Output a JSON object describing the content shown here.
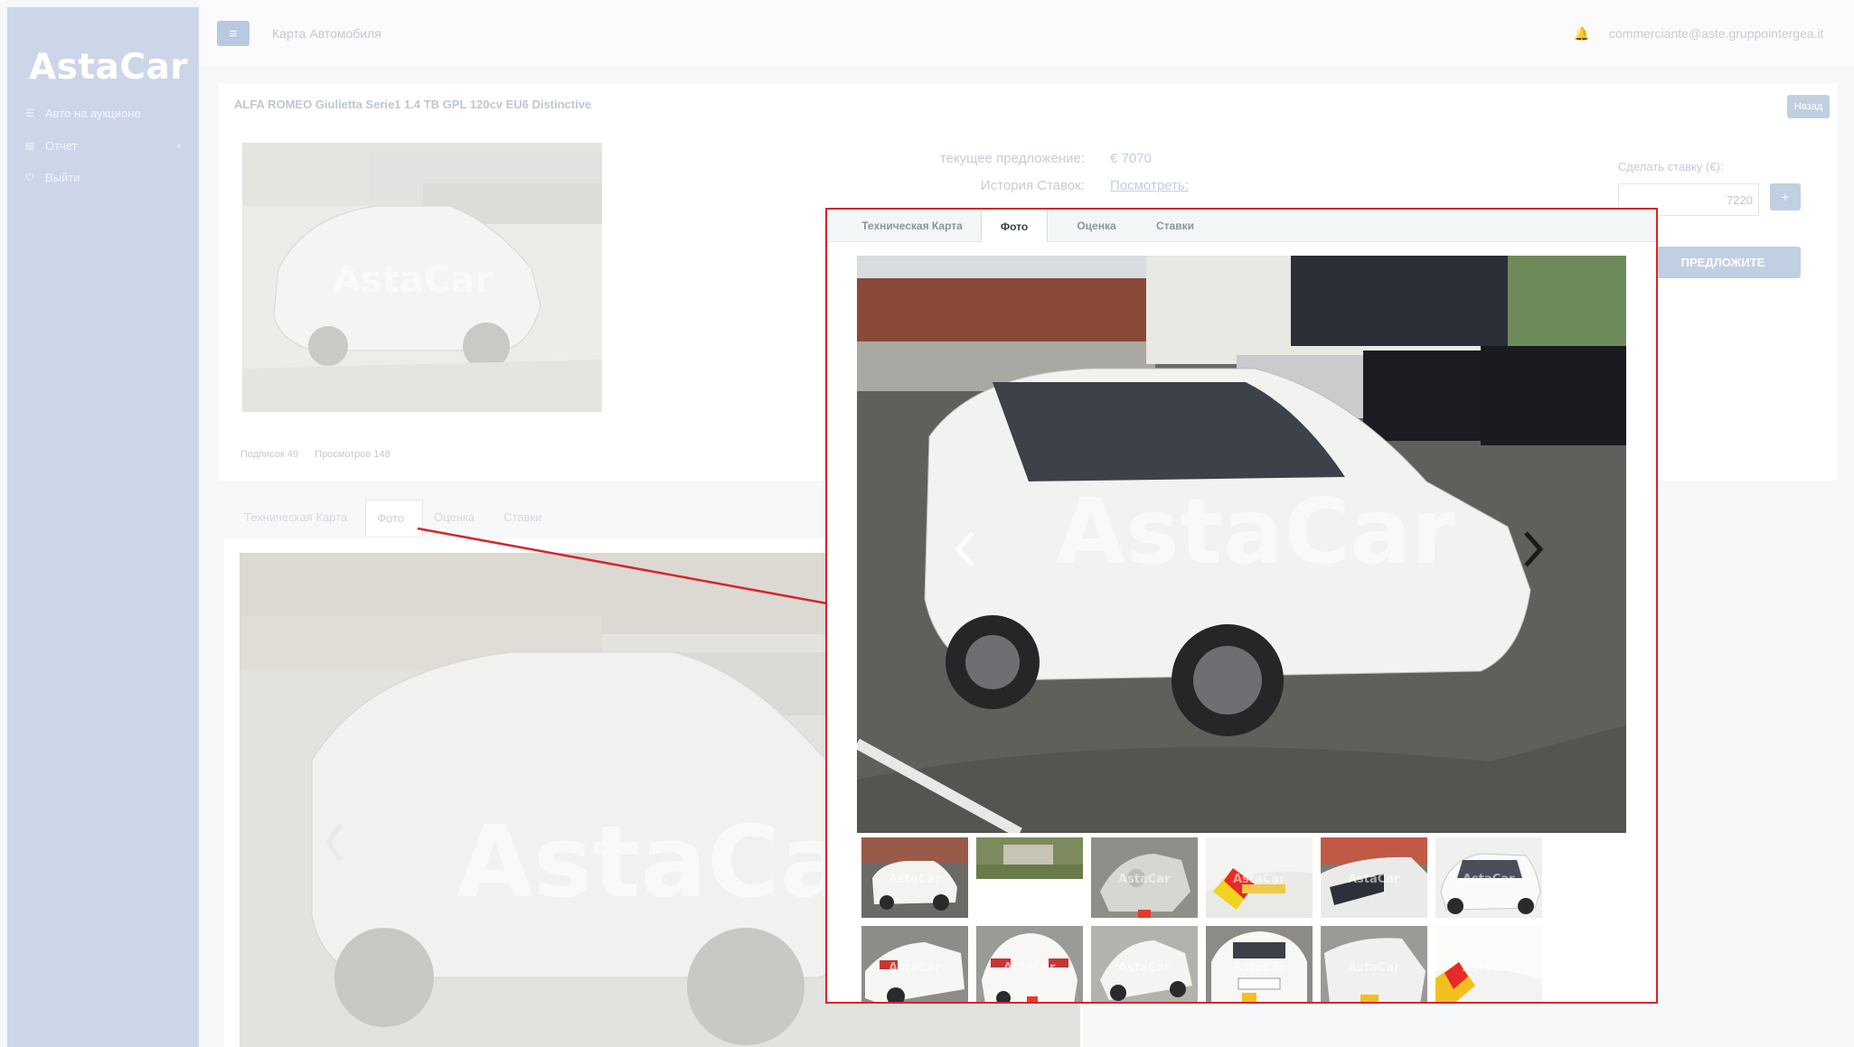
{
  "app": {
    "logo": "AstaCar"
  },
  "sidebar": {
    "items": [
      {
        "label": "Авто на аукционе",
        "icon": "list-icon"
      },
      {
        "label": "Отчет",
        "icon": "document-icon"
      },
      {
        "label": "Выйти",
        "icon": "power-icon"
      }
    ]
  },
  "header": {
    "title": "Карта Автомобиля",
    "user_email": "commerciante@aste.gruppointergea.it"
  },
  "car": {
    "title": "ALFA ROMEO Giulietta Serie1 1.4 TB GPL 120cv EU6 Distinctive",
    "back_label": "Назад",
    "subscriptions": "Подписок 49",
    "views": "Просмотров 148"
  },
  "bid": {
    "current_offer_label": "текущее предложение:",
    "current_offer_value": "€ 7070",
    "history_label": "История Ставок:",
    "history_link": "Посмотреть:",
    "make_bid_label": "Сделать ставку (€):",
    "bid_input_value": "7220",
    "plus_label": "+",
    "offer_button": "ПРЕДЛОЖИТЕ"
  },
  "tabs": [
    {
      "label": "Техническая Карта"
    },
    {
      "label": "Фото"
    },
    {
      "label": "Оценка"
    },
    {
      "label": "Ставки"
    }
  ],
  "active_tab": "Фото",
  "gallery": {
    "watermark": "AstaCar",
    "thumbnail_watermark": "AstaCar",
    "thumbnails_count": 12,
    "icons": [
      "chevron-left-icon",
      "chevron-right-icon"
    ]
  },
  "colors": {
    "highlight": "#d6252b",
    "sidebar": "#ccd6e8",
    "accent_button": "#c1cfe2"
  }
}
